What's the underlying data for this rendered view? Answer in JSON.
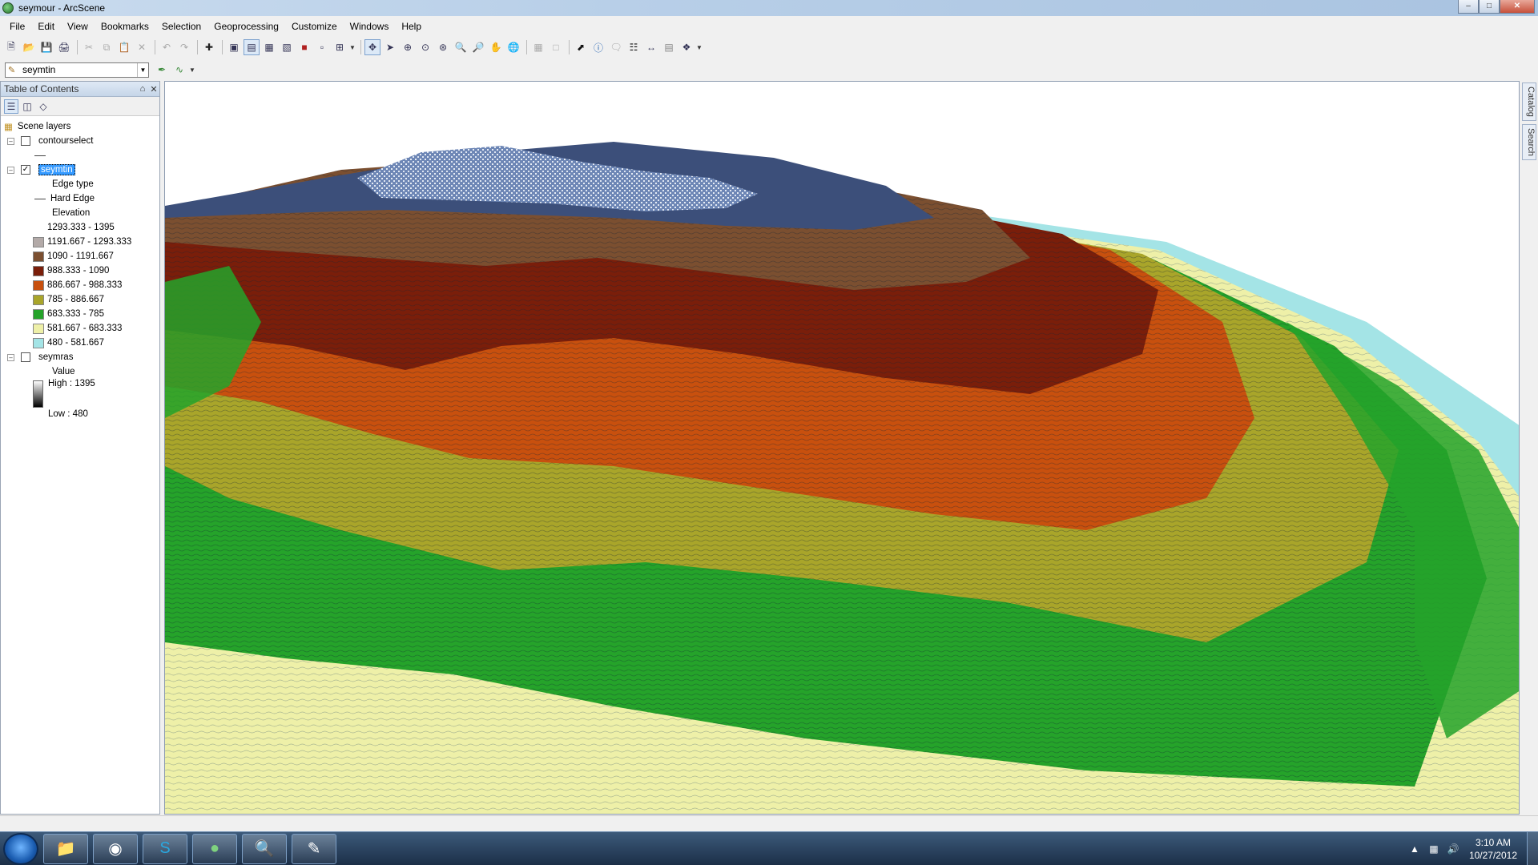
{
  "window": {
    "title": "seymour - ArcScene",
    "minimize": "–",
    "maximize": "□",
    "close": "✕"
  },
  "menu": [
    "File",
    "Edit",
    "View",
    "Bookmarks",
    "Selection",
    "Geoprocessing",
    "Customize",
    "Windows",
    "Help"
  ],
  "toolbar": {
    "icons": [
      "new-document-icon",
      "open-icon",
      "save-icon",
      "print-icon",
      "cut-icon",
      "copy-icon",
      "paste-icon",
      "delete-icon",
      "undo-icon",
      "redo-icon",
      "add-data-icon",
      "scene-properties-icon",
      "toc-window-icon",
      "catalog-window-icon",
      "search-window-icon",
      "arctoolbox-icon",
      "model-builder-icon",
      "navigate-icon",
      "fly-icon",
      "target-center-icon",
      "zoom-to-target-icon",
      "set-observer-icon",
      "zoom-in-icon",
      "zoom-out-icon",
      "pan-icon",
      "full-extent-icon",
      "select-features-icon",
      "identify-icon",
      "html-popup-icon",
      "find-icon",
      "measure-icon",
      "animation-icon",
      "3d-effects-icon"
    ],
    "layer_selector": "seymtin"
  },
  "toc": {
    "title": "Table of Contents",
    "pin": "⌂",
    "close": "✕",
    "root": "Scene layers",
    "layers": [
      {
        "name": "contourselect",
        "checked": false
      },
      {
        "name": "seymtin",
        "checked": true
      },
      {
        "name": "seymras",
        "checked": false
      }
    ],
    "seymtin": {
      "edge_heading": "Edge type",
      "edge_label": "Hard Edge",
      "elevation_heading": "Elevation",
      "classes": [
        {
          "label": "1293.333 - 1395",
          "color": "#ffffff"
        },
        {
          "label": "1191.667 - 1293.333",
          "color": "#b3aaa8"
        },
        {
          "label": "1090 - 1191.667",
          "color": "#7b4f30"
        },
        {
          "label": "988.333 - 1090",
          "color": "#7a1e0a"
        },
        {
          "label": "886.667 - 988.333",
          "color": "#c8500e"
        },
        {
          "label": "785 - 886.667",
          "color": "#a9a52a"
        },
        {
          "label": "683.333 - 785",
          "color": "#25a32a"
        },
        {
          "label": "581.667 - 683.333",
          "color": "#eef0a8"
        },
        {
          "label": "480 - 581.667",
          "color": "#a4e4e6"
        }
      ]
    },
    "seymras": {
      "heading": "Value",
      "high": "High : 1395",
      "low": "Low : 480"
    }
  },
  "dock": {
    "catalog": "Catalog",
    "search": "Search"
  },
  "taskbar": {
    "apps": [
      "explorer",
      "chrome",
      "skype",
      "arcscene",
      "search",
      "paint"
    ],
    "time": "3:10 AM",
    "date": "10/27/2012"
  }
}
